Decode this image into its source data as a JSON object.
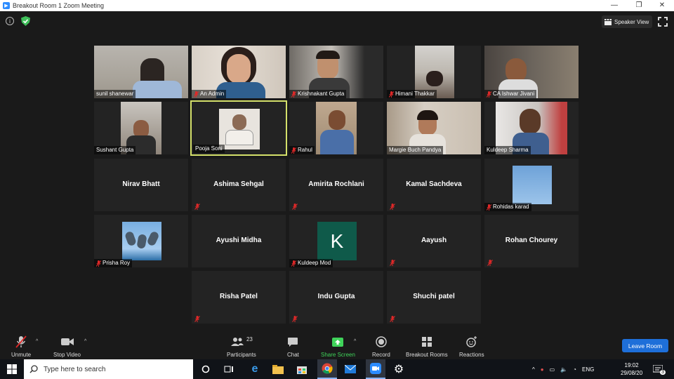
{
  "window": {
    "title": "Breakout Room 1   Zoom Meeting"
  },
  "top_bar": {
    "speaker_view_label": "Speaker View"
  },
  "participants": [
    {
      "name": "sunil shanewar",
      "muted": false,
      "video": true
    },
    {
      "name": "An Admin",
      "muted": true,
      "video": true
    },
    {
      "name": "Krishnakant Gupta",
      "muted": true,
      "video": true
    },
    {
      "name": "Himani Thakkar",
      "muted": true,
      "video": true
    },
    {
      "name": "CA Ishwar Jivani",
      "muted": true,
      "video": true
    },
    {
      "name": "Sushant Gupta",
      "muted": false,
      "video": true
    },
    {
      "name": "Pooja Soni",
      "muted": false,
      "video": true,
      "active": true
    },
    {
      "name": "Rahul",
      "muted": true,
      "video": true
    },
    {
      "name": "Margie Buch Pandya",
      "muted": false,
      "video": true
    },
    {
      "name": "Kuldeep Sharma",
      "muted": false,
      "video": true
    },
    {
      "name": "Nirav Bhatt",
      "muted": false,
      "video": false
    },
    {
      "name": "Ashima Sehgal",
      "muted": true,
      "video": false
    },
    {
      "name": "Amirita Rochlani",
      "muted": true,
      "video": false
    },
    {
      "name": "Kamal Sachdeva",
      "muted": true,
      "video": false
    },
    {
      "name": "Rohidas karad",
      "muted": true,
      "video": false,
      "picture": true
    },
    {
      "name": "Prisha Roy",
      "muted": true,
      "video": false,
      "picture": true
    },
    {
      "name": "Ayushi Midha",
      "muted": false,
      "video": false
    },
    {
      "name": "Kuldeep Mod",
      "muted": true,
      "video": false,
      "avatar_letter": "K"
    },
    {
      "name": "Aayush",
      "muted": true,
      "video": false
    },
    {
      "name": "Rohan Chourey",
      "muted": true,
      "video": false
    },
    {
      "name": "Risha Patel",
      "muted": true,
      "video": false
    },
    {
      "name": "Indu Gupta",
      "muted": true,
      "video": false
    },
    {
      "name": "Shuchi patel",
      "muted": true,
      "video": false
    }
  ],
  "toolbar": {
    "unmute": "Unmute",
    "stop_video": "Stop Video",
    "participants": "Participants",
    "participants_count": "23",
    "chat": "Chat",
    "share_screen": "Share Screen",
    "record": "Record",
    "breakout_rooms": "Breakout Rooms",
    "reactions": "Reactions",
    "leave_room": "Leave Room"
  },
  "taskbar": {
    "search_placeholder": "Type here to search",
    "lang": "ENG",
    "time": "19:02",
    "date": "29/08/20",
    "notification_count": "3"
  },
  "colors": {
    "accent": "#2d8cff",
    "active_border": "#d4e06a",
    "share_green": "#3fd35a",
    "leave_blue": "#1e6fd9",
    "muted_red": "#e02828"
  }
}
